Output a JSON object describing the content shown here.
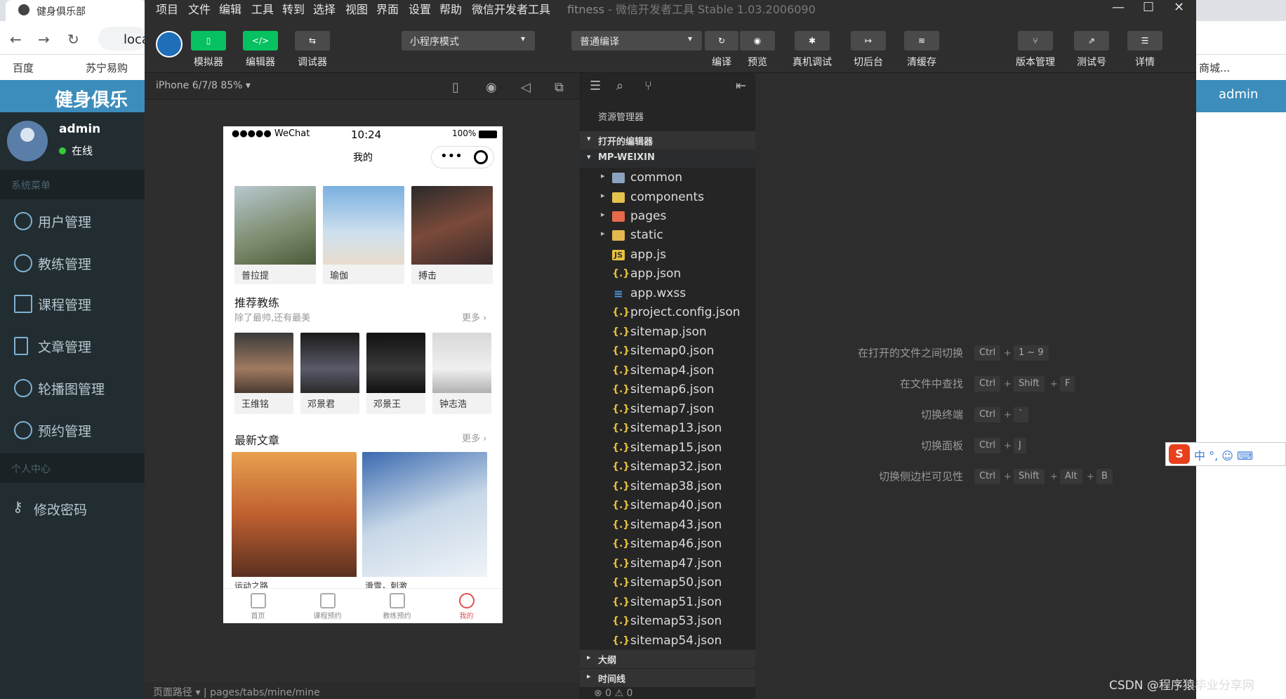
{
  "browser": {
    "tab_title": "健身俱乐部",
    "url_partial": "loca",
    "bookmarks": [
      "百度",
      "苏宁易购"
    ],
    "bookmark_right": "商城..."
  },
  "admin": {
    "brand": "健身俱乐部",
    "user_name": "admin",
    "user_status": "在线",
    "section_system": "系统菜单",
    "section_personal": "个人中心",
    "menu": [
      "用户管理",
      "教练管理",
      "课程管理",
      "文章管理",
      "轮播图管理",
      "预约管理"
    ],
    "change_password": "修改密码",
    "right_user": "admin"
  },
  "devtools": {
    "menu": [
      "项目",
      "文件",
      "编辑",
      "工具",
      "转到",
      "选择",
      "视图",
      "界面",
      "设置",
      "帮助",
      "微信开发者工具"
    ],
    "title_project": "fitness",
    "title_rest": "- 微信开发者工具 Stable 1.03.2006090",
    "toolbar": {
      "simulator": "模拟器",
      "editor": "编辑器",
      "debugger": "调试器",
      "mode": "小程序模式",
      "compile_mode": "普通编译",
      "compile": "编译",
      "preview": "预览",
      "remote_debug": "真机调试",
      "background": "切后台",
      "clear_cache": "清缓存",
      "version": "版本管理",
      "test_id": "测试号",
      "details": "详情"
    },
    "device": "iPhone 6/7/8 85% ▾",
    "page_path_label": "页面路径 ▾",
    "page_path": "pages/tabs/mine/mine",
    "errors": "⊗ 0 ⚠ 0"
  },
  "phone": {
    "carrier": "●●●●● WeChat",
    "time": "10:24",
    "battery": "100%",
    "nav_title": "我的",
    "courses": [
      {
        "name": "普拉提"
      },
      {
        "name": "瑜伽"
      },
      {
        "name": "搏击"
      }
    ],
    "coach_title": "推荐教练",
    "coach_subtitle": "除了最帅,还有最美",
    "more": "更多",
    "coaches": [
      "王维铭",
      "邓景君",
      "邓景王",
      "钟志浩"
    ],
    "article_title": "最新文章",
    "articles": [
      "运动之路",
      "滑雪，刺激"
    ],
    "tabs": [
      "首页",
      "课程预约",
      "教练预约",
      "我的"
    ]
  },
  "explorer": {
    "title": "资源管理器",
    "open_editors": "打开的编辑器",
    "project": "MP-WEIXIN",
    "folders": [
      "common",
      "components",
      "pages",
      "static"
    ],
    "files": [
      "app.js",
      "app.json",
      "app.wxss",
      "project.config.json",
      "sitemap.json",
      "sitemap0.json",
      "sitemap4.json",
      "sitemap6.json",
      "sitemap7.json",
      "sitemap13.json",
      "sitemap15.json",
      "sitemap32.json",
      "sitemap38.json",
      "sitemap40.json",
      "sitemap43.json",
      "sitemap46.json",
      "sitemap47.json",
      "sitemap50.json",
      "sitemap51.json",
      "sitemap53.json",
      "sitemap54.json"
    ],
    "outline": "大纲",
    "timeline": "时间线"
  },
  "shortcuts": [
    {
      "label": "在打开的文件之间切换",
      "keys": [
        "Ctrl",
        "1 ~ 9"
      ]
    },
    {
      "label": "在文件中查找",
      "keys": [
        "Ctrl",
        "Shift",
        "F"
      ]
    },
    {
      "label": "切换终端",
      "keys": [
        "Ctrl",
        "`"
      ]
    },
    {
      "label": "切换面板",
      "keys": [
        "Ctrl",
        "J"
      ]
    },
    {
      "label": "切换侧边栏可见性",
      "keys": [
        "Ctrl",
        "Shift",
        "Alt",
        "B"
      ]
    }
  ],
  "watermark": "CSDN @程序猿毕业分享网",
  "ime": "中 °, ☺ ⌨"
}
